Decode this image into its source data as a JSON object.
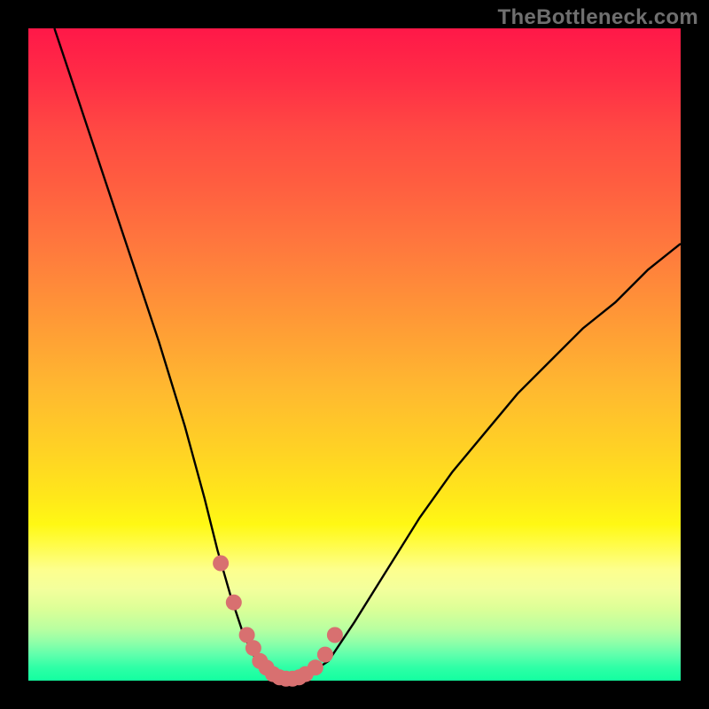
{
  "watermark": "TheBottleneck.com",
  "chart_data": {
    "type": "line",
    "title": "",
    "xlabel": "",
    "ylabel": "",
    "xlim": [
      0,
      100
    ],
    "ylim": [
      0,
      100
    ],
    "grid": false,
    "legend": false,
    "series": [
      {
        "name": "curve",
        "color": "#000000",
        "x": [
          4,
          8,
          12,
          16,
          20,
          24,
          27,
          29,
          31,
          33,
          35,
          37,
          39,
          41,
          43,
          46,
          50,
          55,
          60,
          65,
          70,
          75,
          80,
          85,
          90,
          95,
          100
        ],
        "y": [
          100,
          88,
          76,
          64,
          52,
          39,
          28,
          20,
          13,
          7,
          3,
          1,
          0,
          0,
          1,
          3,
          9,
          17,
          25,
          32,
          38,
          44,
          49,
          54,
          58,
          63,
          67
        ]
      },
      {
        "name": "highlight-dots",
        "color": "#D87070",
        "x": [
          29.5,
          31.5,
          33.5,
          34.5,
          35.5,
          36.5,
          37.5,
          38.5,
          39.5,
          40.5,
          41.5,
          42.5,
          44.0,
          45.5,
          47.0
        ],
        "y": [
          18,
          12,
          7,
          5,
          3,
          2,
          1,
          0.5,
          0.3,
          0.3,
          0.5,
          1,
          2,
          4,
          7
        ]
      }
    ]
  },
  "colors": {
    "gradient_top": "#ff1848",
    "gradient_mid": "#ffe81a",
    "gradient_bottom": "#13ffa0",
    "curve": "#000000",
    "dots": "#D87070",
    "background": "#000000"
  }
}
